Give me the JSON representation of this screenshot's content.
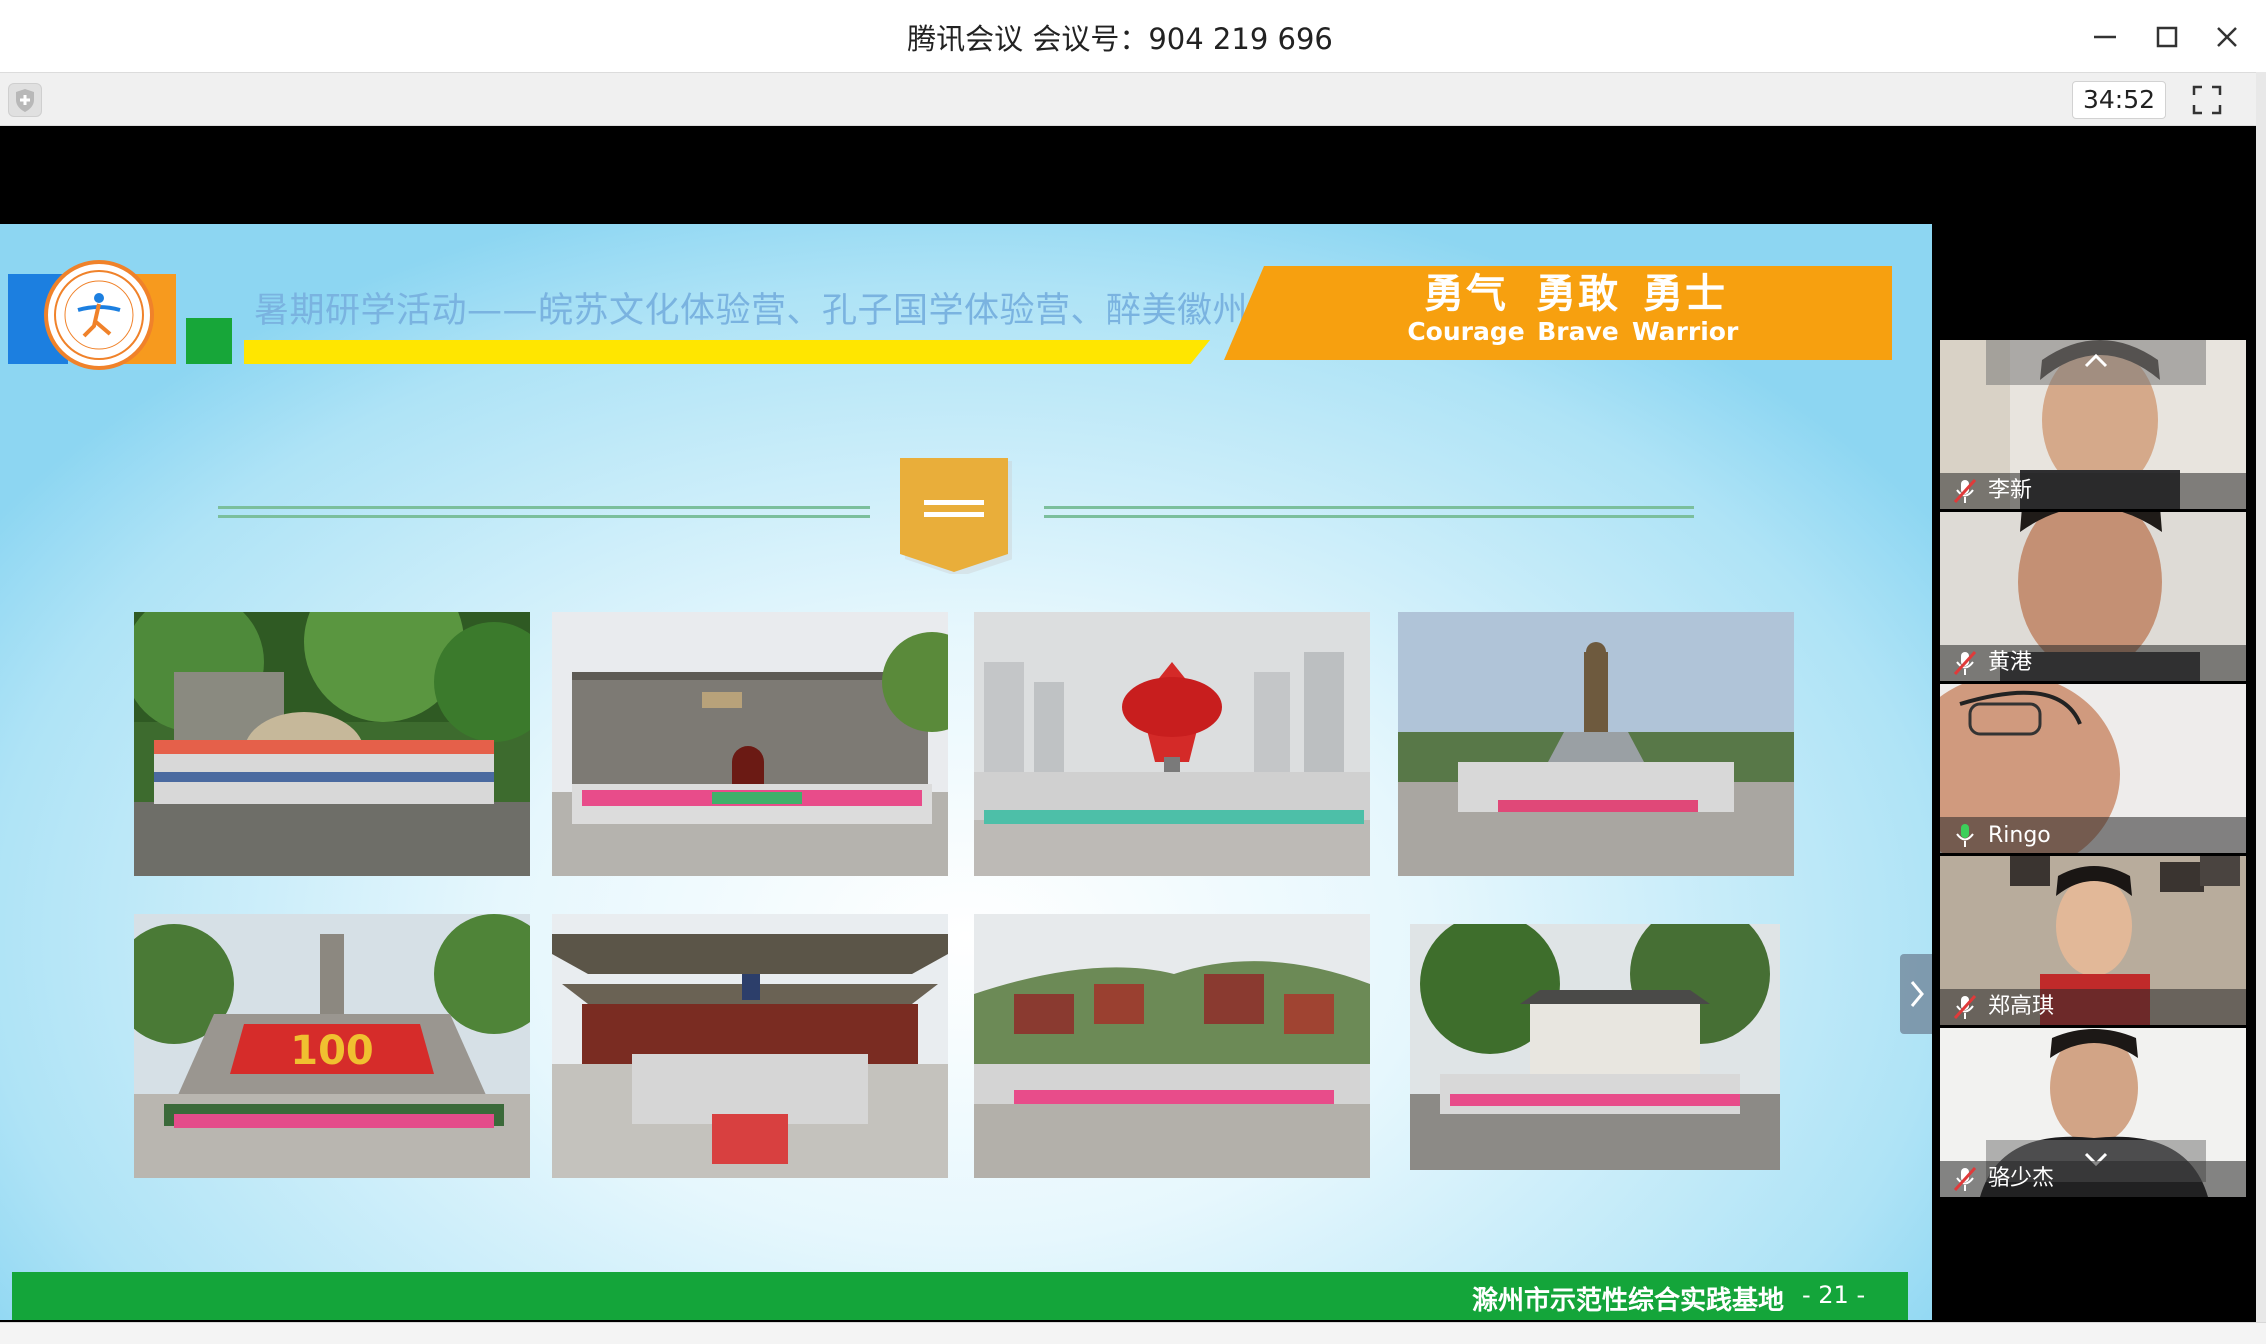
{
  "window": {
    "title": "腾讯会议 会议号：904 219 696",
    "minimize_icon": "minimize-icon",
    "maximize_icon": "maximize-icon",
    "close_icon": "close-icon"
  },
  "toolbar": {
    "shield_icon": "shield-icon",
    "timer": "34:52",
    "fullscreen_icon": "fullscreen-icon"
  },
  "slide": {
    "header_text": "暑期研学活动——皖苏文化体验营、孔子国学体验营、醉美徽州自然行",
    "motto": [
      {
        "cn": "勇气",
        "en": "Courage"
      },
      {
        "cn": "勇敢",
        "en": "Brave"
      },
      {
        "cn": "勇士",
        "en": "Warrior"
      }
    ],
    "footer_org": "滁州市示范性综合实践基地",
    "footer_page": "- 21 -",
    "colors": {
      "blue": "#1c7fe0",
      "orange": "#f7a00f",
      "green": "#14a53a",
      "yellow": "#ffe600",
      "ribbon": "#e9ae3a"
    },
    "photos": [
      "group-photo-forest-rock",
      "group-photo-city-wall",
      "group-photo-red-sculpture",
      "group-photo-confucius-statue",
      "group-photo-monument-stairs",
      "group-photo-temple-hall",
      "group-photo-hillside-town",
      "group-photo-old-building"
    ]
  },
  "participants": [
    {
      "name": "李新",
      "mic": "muted"
    },
    {
      "name": "黄港",
      "mic": "muted"
    },
    {
      "name": "Ringo",
      "mic": "active"
    },
    {
      "name": "郑高琪",
      "mic": "muted"
    },
    {
      "name": "骆少杰",
      "mic": "muted"
    }
  ]
}
